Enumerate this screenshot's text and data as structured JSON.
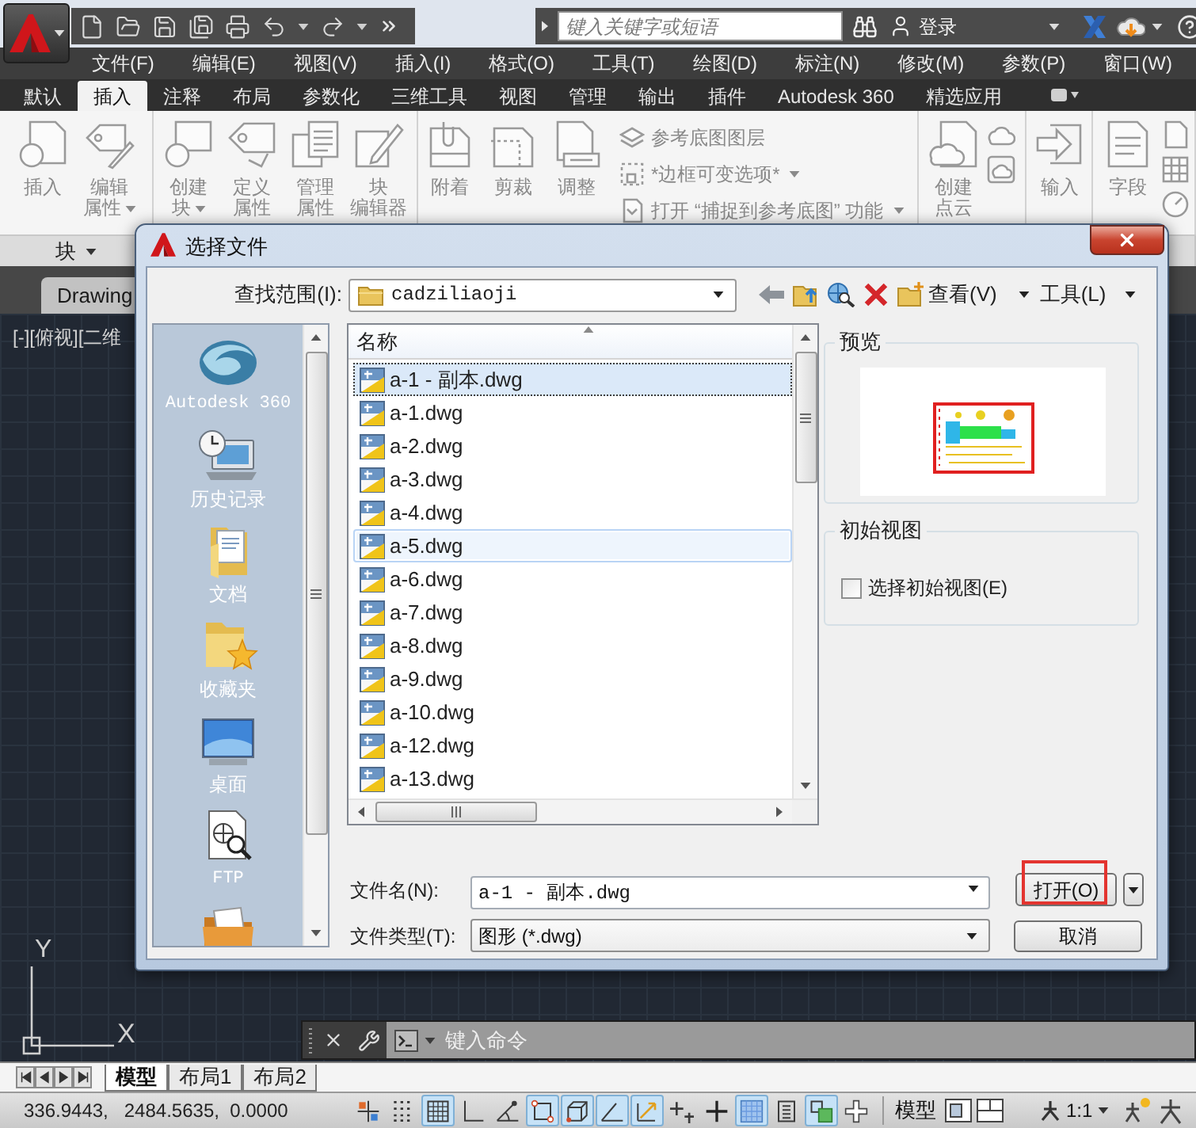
{
  "title_bar": {
    "search": {
      "placeholder": "键入关键字或短语"
    },
    "sign_in": "登录"
  },
  "menu_bar": [
    "文件(F)",
    "编辑(E)",
    "视图(V)",
    "插入(I)",
    "格式(O)",
    "工具(T)",
    "绘图(D)",
    "标注(N)",
    "修改(M)",
    "参数(P)",
    "窗口(W)"
  ],
  "ribbon_tabs": [
    {
      "label": "默认",
      "selected": false
    },
    {
      "label": "插入",
      "selected": true
    },
    {
      "label": "注释",
      "selected": false
    },
    {
      "label": "布局",
      "selected": false
    },
    {
      "label": "参数化",
      "selected": false
    },
    {
      "label": "三维工具",
      "selected": false
    },
    {
      "label": "视图",
      "selected": false
    },
    {
      "label": "管理",
      "selected": false
    },
    {
      "label": "输出",
      "selected": false
    },
    {
      "label": "插件",
      "selected": false
    },
    {
      "label": "Autodesk 360",
      "selected": false
    },
    {
      "label": "精选应用",
      "selected": false
    }
  ],
  "ribbon_panels": [
    {
      "title": "块",
      "items": [
        {
          "kind": "large",
          "lines": [
            "插入"
          ]
        },
        {
          "kind": "large",
          "lines": [
            "编辑",
            "属性"
          ],
          "dropdown": true
        }
      ]
    },
    {
      "items": [
        {
          "kind": "large",
          "lines": [
            "创建",
            "块"
          ],
          "dropdown": true
        },
        {
          "kind": "large",
          "lines": [
            "定义",
            "属性"
          ]
        },
        {
          "kind": "large",
          "lines": [
            "管理",
            "属性"
          ]
        },
        {
          "kind": "large",
          "lines": [
            "块",
            "编辑器"
          ]
        }
      ]
    },
    {
      "items": [
        {
          "kind": "large",
          "lines": [
            "附着"
          ]
        },
        {
          "kind": "large",
          "lines": [
            "剪裁"
          ]
        },
        {
          "kind": "large",
          "lines": [
            "调整"
          ]
        },
        {
          "kind": "stack",
          "rows": [
            {
              "label": "参考底图图层"
            },
            {
              "label": "*边框可变选项*",
              "dropdown": true
            },
            {
              "label": "打开 “捕捉到参考底图” 功能",
              "dropdown": true
            }
          ]
        }
      ]
    },
    {
      "items": [
        {
          "kind": "large",
          "lines": [
            "创建",
            "点云"
          ]
        },
        {
          "kind": "icon_stack"
        }
      ]
    },
    {
      "items": [
        {
          "kind": "large",
          "lines": [
            "输入"
          ]
        }
      ]
    },
    {
      "items": [
        {
          "kind": "large",
          "lines": [
            "字段"
          ]
        },
        {
          "kind": "icon_stack"
        }
      ]
    }
  ],
  "document_tab": "Drawing",
  "viewport_label": "[-][俯视][二维",
  "ucs": {
    "y_label": "Y",
    "x_label": "X"
  },
  "command_line": {
    "placeholder": "键入命令"
  },
  "layout_tabs": [
    {
      "label": "模型",
      "selected": true
    },
    {
      "label": "布局1",
      "selected": false
    },
    {
      "label": "布局2",
      "selected": false
    }
  ],
  "status_bar": {
    "coordinates": "336.9443,   2484.5635,  0.0000",
    "toggles": [
      {
        "on": false
      },
      {
        "on": false
      },
      {
        "on": true
      },
      {
        "on": false
      },
      {
        "on": false
      },
      {
        "on": true
      },
      {
        "on": true
      },
      {
        "on": true
      },
      {
        "on": true
      },
      {
        "on": false
      },
      {
        "on": false
      },
      {
        "on": true
      },
      {
        "on": false
      },
      {
        "on": true
      },
      {
        "on": false
      }
    ],
    "model_button": "模型",
    "annotation_scale": "1:1"
  },
  "dialog": {
    "title": "选择文件",
    "look_in": {
      "label": "查找范围(I):",
      "value": "cadziliaoji"
    },
    "menus": [
      "查看(V)",
      "工具(L)"
    ],
    "places": [
      {
        "kind": "cloud",
        "label": "Autodesk 360"
      },
      {
        "kind": "history",
        "label": "历史记录"
      },
      {
        "kind": "documents",
        "label": "文档"
      },
      {
        "kind": "favorites",
        "label": "收藏夹"
      },
      {
        "kind": "desktop",
        "label": "桌面"
      },
      {
        "kind": "ftp",
        "label": "FTP"
      },
      {
        "kind": "folder"
      }
    ],
    "file_list": {
      "column": "名称",
      "rows": [
        {
          "name": "a-1 - 副本.dwg",
          "selected": true,
          "hovered": false
        },
        {
          "name": "a-1.dwg",
          "selected": false,
          "hovered": false
        },
        {
          "name": "a-2.dwg",
          "selected": false,
          "hovered": false
        },
        {
          "name": "a-3.dwg",
          "selected": false,
          "hovered": false
        },
        {
          "name": "a-4.dwg",
          "selected": false,
          "hovered": false
        },
        {
          "name": "a-5.dwg",
          "selected": false,
          "hovered": true
        },
        {
          "name": "a-6.dwg",
          "selected": false,
          "hovered": false
        },
        {
          "name": "a-7.dwg",
          "selected": false,
          "hovered": false
        },
        {
          "name": "a-8.dwg",
          "selected": false,
          "hovered": false
        },
        {
          "name": "a-9.dwg",
          "selected": false,
          "hovered": false
        },
        {
          "name": "a-10.dwg",
          "selected": false,
          "hovered": false
        },
        {
          "name": "a-12.dwg",
          "selected": false,
          "hovered": false
        },
        {
          "name": "a-13.dwg",
          "selected": false,
          "hovered": false
        }
      ]
    },
    "preview": {
      "title": "预览"
    },
    "initial_view": {
      "title": "初始视图",
      "checkbox": {
        "label": "选择初始视图(E)",
        "checked": false
      }
    },
    "file_name": {
      "label": "文件名(N):",
      "value": "a-1 - 副本.dwg"
    },
    "file_type": {
      "label": "文件类型(T):",
      "value": "图形 (*.dwg)"
    },
    "open_button": {
      "label": "打开(O)",
      "highlighted": true
    },
    "cancel_button": {
      "label": "取消"
    }
  }
}
